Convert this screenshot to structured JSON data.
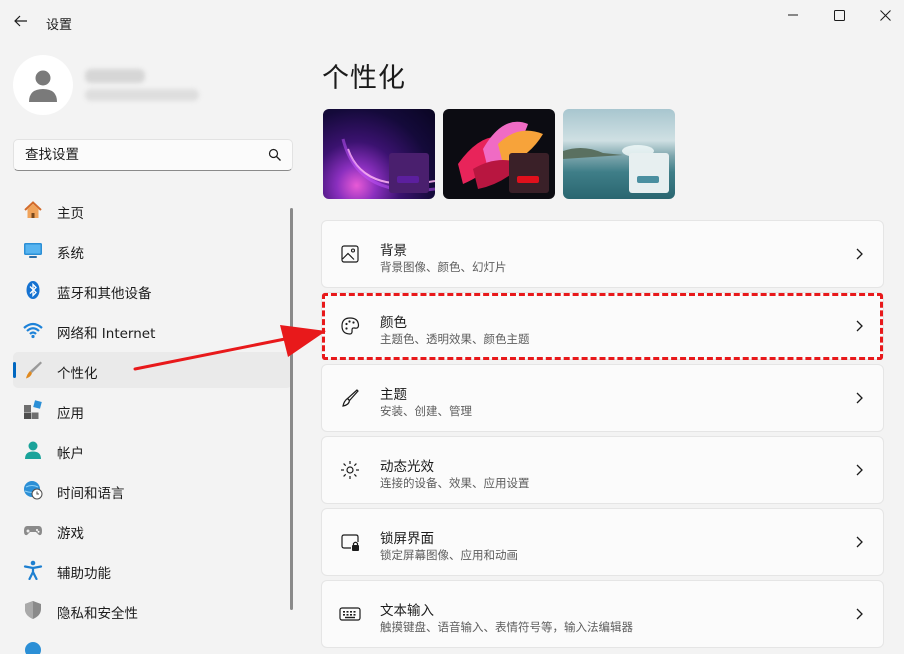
{
  "window": {
    "title": "设置"
  },
  "search": {
    "placeholder": "查找设置"
  },
  "nav": {
    "items": [
      {
        "label": "主页"
      },
      {
        "label": "系统"
      },
      {
        "label": "蓝牙和其他设备"
      },
      {
        "label": "网络和 Internet"
      },
      {
        "label": "个性化"
      },
      {
        "label": "应用"
      },
      {
        "label": "帐户"
      },
      {
        "label": "时间和语言"
      },
      {
        "label": "游戏"
      },
      {
        "label": "辅助功能"
      },
      {
        "label": "隐私和安全性"
      }
    ],
    "active": "个性化"
  },
  "main": {
    "title": "个性化",
    "themes": [
      {
        "name": "theme-glow",
        "accent": "#5c1f9e"
      },
      {
        "name": "theme-flow",
        "accent": "#e0101c"
      },
      {
        "name": "theme-sunrise",
        "accent": "#4a8fa0"
      }
    ],
    "cards": [
      {
        "title": "背景",
        "subtitle": "背景图像、颜色、幻灯片",
        "icon": "picture-icon"
      },
      {
        "title": "颜色",
        "subtitle": "主题色、透明效果、颜色主题",
        "icon": "palette-icon"
      },
      {
        "title": "主题",
        "subtitle": "安装、创建、管理",
        "icon": "brush-icon"
      },
      {
        "title": "动态光效",
        "subtitle": "连接的设备、效果、应用设置",
        "icon": "lighting-icon"
      },
      {
        "title": "锁屏界面",
        "subtitle": "锁定屏幕图像、应用和动画",
        "icon": "lock-screen-icon"
      },
      {
        "title": "文本输入",
        "subtitle": "触摸键盘、语音输入、表情符号等，输入法编辑器",
        "icon": "keyboard-icon"
      }
    ]
  },
  "colors": {
    "accent": "#0067c0",
    "annotation": "#e8191b"
  }
}
